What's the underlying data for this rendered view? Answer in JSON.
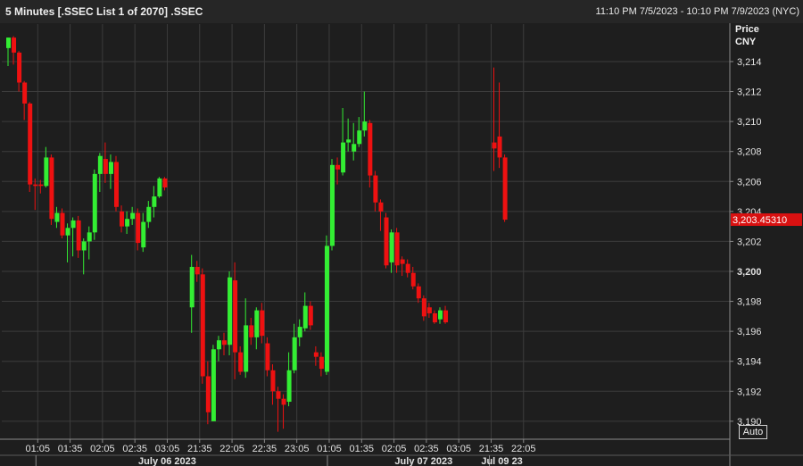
{
  "header": {
    "title": "5 Minutes [.SSEC List 1 of 2070] .SSEC",
    "range": "11:10 PM 7/5/2023 - 10:10 PM 7/9/2023 (NYC)"
  },
  "controls": {
    "auto_label": "Auto"
  },
  "colors": {
    "up": "#33ee33",
    "down": "#ee1111",
    "grid": "#3c3c3c",
    "background": "#1e1e1e",
    "last_price_bg": "#d91111"
  },
  "chart_data": {
    "type": "candlestick",
    "price_header": [
      "Price",
      "CNY"
    ],
    "ylim": [
      3188.8,
      3216.5
    ],
    "y_ticks": [
      3190,
      3192,
      3194,
      3196,
      3198,
      3200,
      3202,
      3204,
      3206,
      3208,
      3210,
      3212,
      3214
    ],
    "y_tick_labels": [
      "3,190",
      "3,192",
      "3,194",
      "3,196",
      "3,198",
      "3,200",
      "3,202",
      "3,204",
      "3,206",
      "3,208",
      "3,210",
      "3,212",
      "3,214"
    ],
    "bold_ticks": [
      3200
    ],
    "x_ticks": [
      {
        "slot": 5.5,
        "label": "01:05"
      },
      {
        "slot": 11.5,
        "label": "01:35"
      },
      {
        "slot": 17.5,
        "label": "02:05"
      },
      {
        "slot": 23.5,
        "label": "02:35"
      },
      {
        "slot": 29.5,
        "label": "03:05"
      },
      {
        "slot": 35.5,
        "label": "21:35"
      },
      {
        "slot": 41.5,
        "label": "22:05"
      },
      {
        "slot": 47.5,
        "label": "22:35"
      },
      {
        "slot": 53.5,
        "label": "23:05"
      },
      {
        "slot": 59.5,
        "label": "01:05"
      },
      {
        "slot": 65.5,
        "label": "01:35"
      },
      {
        "slot": 71.5,
        "label": "02:05"
      },
      {
        "slot": 77.5,
        "label": "02:35"
      },
      {
        "slot": 83.5,
        "label": "03:05"
      },
      {
        "slot": 89.5,
        "label": "21:35"
      },
      {
        "slot": 95.5,
        "label": "22:05"
      }
    ],
    "date_labels": [
      {
        "slot": 29.5,
        "label": "July 06 2023"
      },
      {
        "slot": 77,
        "label": "July 07 2023"
      },
      {
        "slot": 91.5,
        "label": "Jul 09 23"
      }
    ],
    "session_breaks": [
      5.5,
      59.5,
      89.5
    ],
    "last_price": 3203.4531,
    "last_price_label": "3,203.45310",
    "candles": [
      {
        "slot": 0,
        "o": 3214.9,
        "h": 3215.6,
        "l": 3213.7,
        "c": 3215.6
      },
      {
        "slot": 1,
        "o": 3215.6,
        "h": 3215.7,
        "l": 3213.8,
        "c": 3214.6
      },
      {
        "slot": 2,
        "o": 3214.6,
        "h": 3214.7,
        "l": 3212.0,
        "c": 3212.6
      },
      {
        "slot": 3,
        "o": 3212.6,
        "h": 3212.7,
        "l": 3210.1,
        "c": 3211.2
      },
      {
        "slot": 4,
        "o": 3211.2,
        "h": 3211.3,
        "l": 3205.3,
        "c": 3205.8
      },
      {
        "slot": 5,
        "o": 3205.8,
        "h": 3206.2,
        "l": 3204.1,
        "c": 3205.7
      },
      {
        "slot": 6,
        "o": 3205.8,
        "h": 3206.1,
        "l": 3205.2,
        "c": 3205.7
      },
      {
        "slot": 7,
        "o": 3205.7,
        "h": 3208.3,
        "l": 3205.6,
        "c": 3207.6
      },
      {
        "slot": 8,
        "o": 3207.6,
        "h": 3207.8,
        "l": 3203.1,
        "c": 3203.5
      },
      {
        "slot": 9,
        "o": 3203.3,
        "h": 3204.3,
        "l": 3202.9,
        "c": 3203.9
      },
      {
        "slot": 10,
        "o": 3203.9,
        "h": 3204.2,
        "l": 3202.2,
        "c": 3202.4
      },
      {
        "slot": 11,
        "o": 3202.4,
        "h": 3203.2,
        "l": 3200.6,
        "c": 3202.9
      },
      {
        "slot": 12,
        "o": 3202.9,
        "h": 3203.6,
        "l": 3201.0,
        "c": 3203.4
      },
      {
        "slot": 13,
        "o": 3203.4,
        "h": 3203.7,
        "l": 3200.9,
        "c": 3201.4
      },
      {
        "slot": 14,
        "o": 3201.4,
        "h": 3202.2,
        "l": 3199.8,
        "c": 3202.0
      },
      {
        "slot": 15,
        "o": 3202.0,
        "h": 3203.0,
        "l": 3200.8,
        "c": 3202.6
      },
      {
        "slot": 16,
        "o": 3202.6,
        "h": 3206.8,
        "l": 3202.1,
        "c": 3206.5
      },
      {
        "slot": 17,
        "o": 3206.5,
        "h": 3207.9,
        "l": 3205.3,
        "c": 3207.7
      },
      {
        "slot": 18,
        "o": 3207.5,
        "h": 3208.6,
        "l": 3205.9,
        "c": 3206.5
      },
      {
        "slot": 19,
        "o": 3206.5,
        "h": 3207.8,
        "l": 3205.5,
        "c": 3207.3
      },
      {
        "slot": 20,
        "o": 3207.3,
        "h": 3207.7,
        "l": 3204.0,
        "c": 3204.3
      },
      {
        "slot": 21,
        "o": 3204.0,
        "h": 3204.4,
        "l": 3202.6,
        "c": 3203.0
      },
      {
        "slot": 22,
        "o": 3203.0,
        "h": 3204.0,
        "l": 3202.5,
        "c": 3203.5
      },
      {
        "slot": 23,
        "o": 3203.5,
        "h": 3204.3,
        "l": 3203.1,
        "c": 3203.9
      },
      {
        "slot": 24,
        "o": 3203.9,
        "h": 3204.2,
        "l": 3201.4,
        "c": 3201.9
      },
      {
        "slot": 25,
        "o": 3201.6,
        "h": 3203.9,
        "l": 3201.3,
        "c": 3203.3
      },
      {
        "slot": 26,
        "o": 3203.3,
        "h": 3204.7,
        "l": 3202.9,
        "c": 3204.3
      },
      {
        "slot": 27,
        "o": 3204.3,
        "h": 3205.7,
        "l": 3203.6,
        "c": 3205.0
      },
      {
        "slot": 28,
        "o": 3205.0,
        "h": 3206.3,
        "l": 3204.9,
        "c": 3206.2
      },
      {
        "slot": 29,
        "o": 3206.2,
        "h": 3206.3,
        "l": 3205.4,
        "c": 3205.6
      },
      {
        "slot": 34,
        "o": 3197.6,
        "h": 3201.1,
        "l": 3195.9,
        "c": 3200.3
      },
      {
        "slot": 35,
        "o": 3200.3,
        "h": 3200.7,
        "l": 3199.3,
        "c": 3199.8
      },
      {
        "slot": 36,
        "o": 3199.8,
        "h": 3200.2,
        "l": 3192.5,
        "c": 3193.0
      },
      {
        "slot": 37,
        "o": 3193.0,
        "h": 3194.0,
        "l": 3189.8,
        "c": 3190.6
      },
      {
        "slot": 38,
        "o": 3190.0,
        "h": 3195.1,
        "l": 3190.0,
        "c": 3194.8
      },
      {
        "slot": 39,
        "o": 3194.8,
        "h": 3195.7,
        "l": 3194.0,
        "c": 3195.4
      },
      {
        "slot": 40,
        "o": 3195.4,
        "h": 3195.9,
        "l": 3194.4,
        "c": 3195.1
      },
      {
        "slot": 41,
        "o": 3195.1,
        "h": 3200.0,
        "l": 3194.4,
        "c": 3199.6
      },
      {
        "slot": 42,
        "o": 3199.4,
        "h": 3200.6,
        "l": 3192.8,
        "c": 3194.6
      },
      {
        "slot": 43,
        "o": 3194.6,
        "h": 3195.0,
        "l": 3193.1,
        "c": 3193.3
      },
      {
        "slot": 44,
        "o": 3193.3,
        "h": 3198.2,
        "l": 3192.9,
        "c": 3196.4
      },
      {
        "slot": 45,
        "o": 3196.4,
        "h": 3196.9,
        "l": 3195.1,
        "c": 3195.6
      },
      {
        "slot": 46,
        "o": 3195.6,
        "h": 3197.6,
        "l": 3194.8,
        "c": 3197.4
      },
      {
        "slot": 47,
        "o": 3197.4,
        "h": 3197.9,
        "l": 3195.2,
        "c": 3195.7
      },
      {
        "slot": 48,
        "o": 3195.2,
        "h": 3195.6,
        "l": 3193.0,
        "c": 3193.4
      },
      {
        "slot": 49,
        "o": 3193.4,
        "h": 3193.8,
        "l": 3191.1,
        "c": 3192.0
      },
      {
        "slot": 50,
        "o": 3192.0,
        "h": 3192.3,
        "l": 3189.3,
        "c": 3191.5
      },
      {
        "slot": 51,
        "o": 3191.5,
        "h": 3191.8,
        "l": 3189.5,
        "c": 3191.1
      },
      {
        "slot": 52,
        "o": 3191.3,
        "h": 3194.6,
        "l": 3191.0,
        "c": 3193.4
      },
      {
        "slot": 53,
        "o": 3193.4,
        "h": 3196.5,
        "l": 3193.2,
        "c": 3195.6
      },
      {
        "slot": 54,
        "o": 3195.6,
        "h": 3196.8,
        "l": 3195.0,
        "c": 3196.3
      },
      {
        "slot": 55,
        "o": 3196.2,
        "h": 3198.6,
        "l": 3196.0,
        "c": 3197.7
      },
      {
        "slot": 56,
        "o": 3197.7,
        "h": 3198.0,
        "l": 3196.1,
        "c": 3196.4
      },
      {
        "slot": 57,
        "o": 3194.6,
        "h": 3195.0,
        "l": 3193.7,
        "c": 3194.3
      },
      {
        "slot": 58,
        "o": 3194.3,
        "h": 3194.6,
        "l": 3193.0,
        "c": 3193.5
      },
      {
        "slot": 59,
        "o": 3193.3,
        "h": 3202.4,
        "l": 3193.1,
        "c": 3201.7
      },
      {
        "slot": 60,
        "o": 3201.7,
        "h": 3207.5,
        "l": 3201.4,
        "c": 3207.1
      },
      {
        "slot": 61,
        "o": 3207.1,
        "h": 3207.6,
        "l": 3205.8,
        "c": 3206.8
      },
      {
        "slot": 62,
        "o": 3206.6,
        "h": 3210.9,
        "l": 3206.4,
        "c": 3208.6
      },
      {
        "slot": 63,
        "o": 3208.6,
        "h": 3210.2,
        "l": 3208.0,
        "c": 3208.8
      },
      {
        "slot": 64,
        "o": 3208.0,
        "h": 3209.9,
        "l": 3207.4,
        "c": 3208.5
      },
      {
        "slot": 65,
        "o": 3208.5,
        "h": 3210.3,
        "l": 3208.3,
        "c": 3209.4
      },
      {
        "slot": 66,
        "o": 3209.4,
        "h": 3212.0,
        "l": 3209.0,
        "c": 3210.0
      },
      {
        "slot": 67,
        "o": 3209.9,
        "h": 3210.1,
        "l": 3205.6,
        "c": 3206.4
      },
      {
        "slot": 68,
        "o": 3206.4,
        "h": 3206.7,
        "l": 3204.0,
        "c": 3204.6
      },
      {
        "slot": 69,
        "o": 3204.6,
        "h": 3204.8,
        "l": 3202.7,
        "c": 3204.0
      },
      {
        "slot": 70,
        "o": 3203.6,
        "h": 3203.9,
        "l": 3200.2,
        "c": 3200.4
      },
      {
        "slot": 71,
        "o": 3200.6,
        "h": 3202.8,
        "l": 3199.9,
        "c": 3202.6
      },
      {
        "slot": 72,
        "o": 3202.6,
        "h": 3202.9,
        "l": 3199.9,
        "c": 3200.4
      },
      {
        "slot": 73,
        "o": 3200.8,
        "h": 3201.0,
        "l": 3199.7,
        "c": 3200.5
      },
      {
        "slot": 74,
        "o": 3200.5,
        "h": 3200.8,
        "l": 3199.6,
        "c": 3199.9
      },
      {
        "slot": 75,
        "o": 3199.9,
        "h": 3200.3,
        "l": 3198.8,
        "c": 3199.0
      },
      {
        "slot": 76,
        "o": 3199.0,
        "h": 3199.2,
        "l": 3197.9,
        "c": 3198.2
      },
      {
        "slot": 77,
        "o": 3198.2,
        "h": 3198.4,
        "l": 3196.7,
        "c": 3197.0
      },
      {
        "slot": 78,
        "o": 3197.6,
        "h": 3197.9,
        "l": 3196.9,
        "c": 3197.2
      },
      {
        "slot": 79,
        "o": 3197.2,
        "h": 3197.4,
        "l": 3196.5,
        "c": 3196.6
      },
      {
        "slot": 80,
        "o": 3196.8,
        "h": 3197.6,
        "l": 3196.5,
        "c": 3197.4
      },
      {
        "slot": 81,
        "o": 3197.4,
        "h": 3197.7,
        "l": 3196.5,
        "c": 3196.6
      },
      {
        "slot": 90,
        "o": 3208.6,
        "h": 3213.6,
        "l": 3206.7,
        "c": 3208.2
      },
      {
        "slot": 91,
        "o": 3209.0,
        "h": 3212.6,
        "l": 3206.9,
        "c": 3207.6
      },
      {
        "slot": 92,
        "o": 3207.6,
        "h": 3207.8,
        "l": 3203.3,
        "c": 3203.45
      }
    ]
  }
}
